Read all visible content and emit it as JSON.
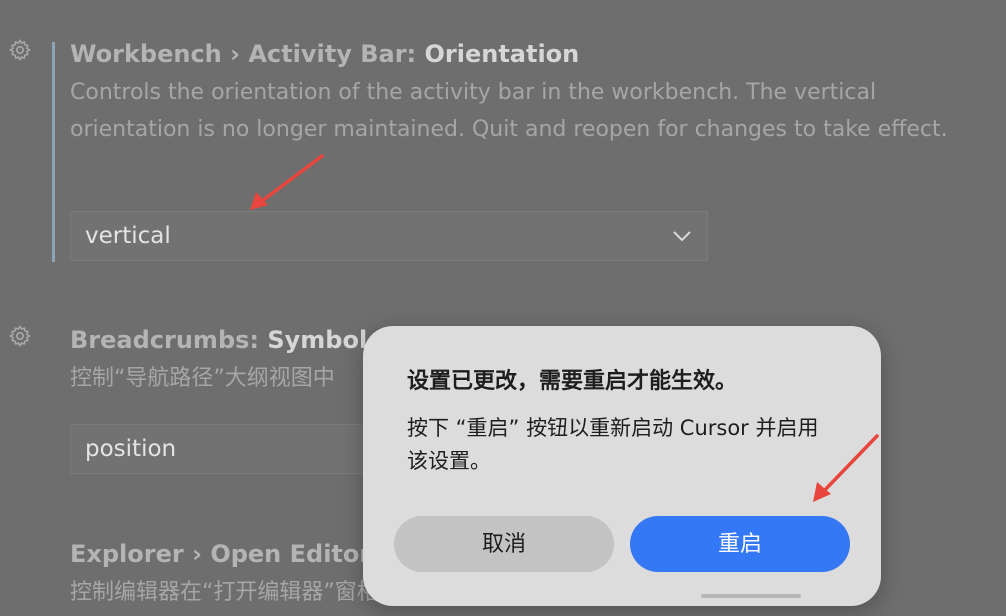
{
  "settings": [
    {
      "breadcrumb": "Workbench › Activity Bar: ",
      "name": "Orientation",
      "description": "Controls the orientation of the activity bar in the workbench. The vertical orientation is no longer maintained. Quit and reopen for changes to take effect.",
      "value": "vertical"
    },
    {
      "breadcrumb": "Breadcrumbs: ",
      "name": "Symbol So",
      "description": "控制“导航路径”大纲视图中",
      "value": "position"
    },
    {
      "breadcrumb": "Explorer › Open Editors",
      "description": "控制编辑器在“打开编辑器”窗格中的排序顺序。"
    }
  ],
  "dialog": {
    "title": "设置已更改，需要重启才能生效。",
    "message": "按下 “重启” 按钮以重新启动 Cursor 并启用该设置。",
    "cancel_label": "取消",
    "restart_label": "重启"
  },
  "colors": {
    "primary_button": "#3478f6",
    "annotation_arrow": "#e8453c"
  },
  "icons": [
    "gear-icon",
    "chevron-down-icon",
    "annotation-arrow"
  ]
}
